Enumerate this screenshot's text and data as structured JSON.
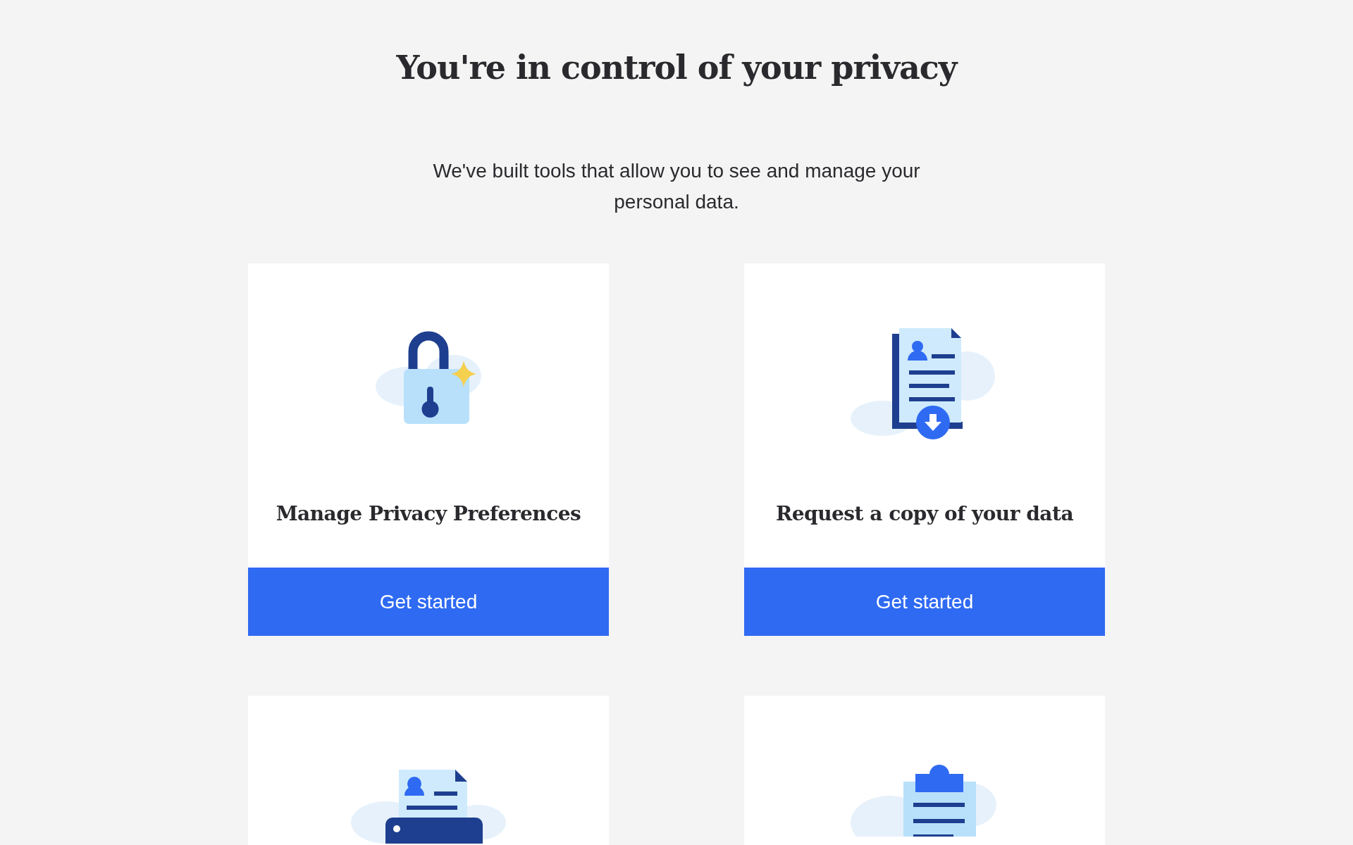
{
  "heading": "You're in control of your privacy",
  "intro": "We've built tools that allow you to see and manage your personal data.",
  "cards": [
    {
      "kind": "lock",
      "title": "Manage Privacy Preferences",
      "button": "Get started"
    },
    {
      "kind": "document-download",
      "title": "Request a copy of your data",
      "button": "Get started"
    },
    {
      "kind": "printer"
    },
    {
      "kind": "clipboard"
    }
  ]
}
